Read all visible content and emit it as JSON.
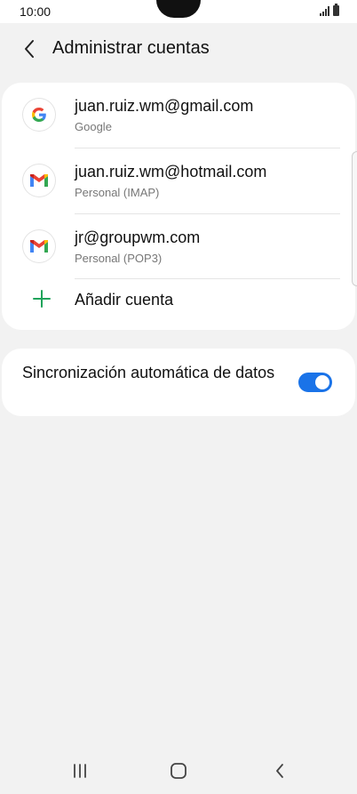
{
  "status_bar": {
    "time": "10:00"
  },
  "header": {
    "title": "Administrar cuentas",
    "back_icon": "chevron-left-icon"
  },
  "accounts": [
    {
      "email": "juan.ruiz.wm@gmail.com",
      "type": "Google",
      "icon": "google-icon"
    },
    {
      "email": "juan.ruiz.wm@hotmail.com",
      "type": "Personal (IMAP)",
      "icon": "gmail-icon"
    },
    {
      "email": "jr@groupwm.com",
      "type": "Personal (POP3)",
      "icon": "gmail-icon"
    }
  ],
  "add_account": {
    "label": "Añadir cuenta",
    "icon": "plus-icon",
    "color": "#1fa35a"
  },
  "sync": {
    "label": "Sincronización automática de datos",
    "enabled": true,
    "color": "#1a73e8"
  },
  "nav": {
    "recent": "recent-apps-icon",
    "home": "home-icon",
    "back": "back-icon"
  }
}
